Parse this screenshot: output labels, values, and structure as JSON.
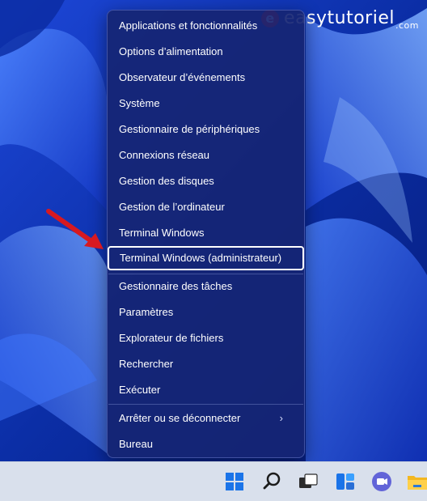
{
  "watermark": {
    "brand": "easytutoriel",
    "suffix": ".com",
    "mark": "e"
  },
  "menu": {
    "items": [
      {
        "label": "Applications et fonctionnalités"
      },
      {
        "label": "Options d’alimentation"
      },
      {
        "label": "Observateur d’événements"
      },
      {
        "label": "Système"
      },
      {
        "label": "Gestionnaire de périphériques"
      },
      {
        "label": "Connexions réseau"
      },
      {
        "label": "Gestion des disques"
      },
      {
        "label": "Gestion de l’ordinateur"
      },
      {
        "label": "Terminal Windows"
      },
      {
        "label": "Terminal Windows (administrateur)"
      },
      {
        "label": "Gestionnaire des tâches"
      },
      {
        "label": "Paramètres"
      },
      {
        "label": "Explorateur de fichiers"
      },
      {
        "label": "Rechercher"
      },
      {
        "label": "Exécuter"
      },
      {
        "label": "Arrêter ou se déconnecter"
      },
      {
        "label": "Bureau"
      }
    ],
    "selected_index": 9,
    "submenu_chevron": "›"
  },
  "taskbar": {
    "icons": [
      "start-icon",
      "search-icon",
      "task-view-icon",
      "widgets-icon",
      "teams-chat-icon",
      "file-explorer-icon"
    ]
  },
  "colors": {
    "menu_bg": "#162573",
    "selection_border": "#ffffff",
    "annotation_arrow": "#d71920",
    "taskbar_bg": "#d9e0ec"
  }
}
